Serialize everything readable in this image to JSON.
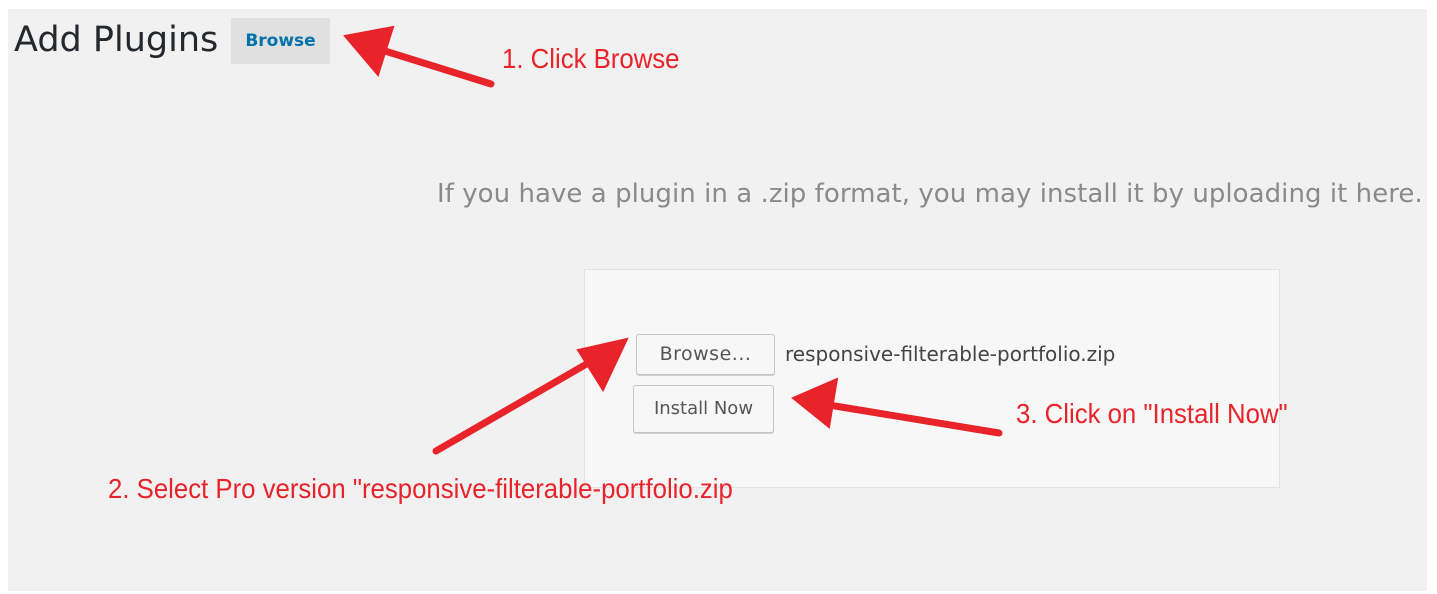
{
  "header": {
    "title": "Add Plugins",
    "action_label": "Browse"
  },
  "upload": {
    "help_text": "If you have a plugin in a .zip format, you may install it by uploading it here.",
    "browse_label": "Browse...",
    "file_name": "responsive-filterable-portfolio.zip",
    "install_label": "Install Now"
  },
  "annotations": {
    "step1": "1. Click Browse",
    "step2": "2. Select Pro version \"responsive-filterable-portfolio.zip",
    "step3": "3. Click on \"Install Now\"",
    "color": "#e8232a"
  },
  "colors": {
    "background": "#f1f1f1",
    "link": "#0073aa",
    "annotation": "#e8232a"
  }
}
